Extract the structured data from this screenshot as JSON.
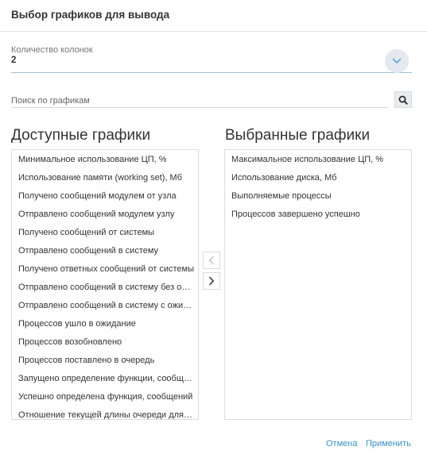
{
  "dialog": {
    "title": "Выбор графиков для вывода"
  },
  "columns": {
    "label": "Количество колонок",
    "value": "2"
  },
  "search": {
    "placeholder": "Поиск по графикам"
  },
  "available": {
    "heading": "Доступные графики",
    "items": [
      "Минимальное использование ЦП, %",
      "Использование памяти (working set), Мб",
      "Получено сообщений модулем от узла",
      "Отправлено сообщений модулем узлу",
      "Получено сообщений от системы",
      "Отправлено сообщений в систему",
      "Получено ответных сообщений от системы",
      "Отправлено сообщений в систему без ожидания ответа",
      "Отправлено сообщений в систему с ожиданием ответа",
      "Процессов ушло в ожидание",
      "Процессов возобновлено",
      "Процессов поставлено в очередь",
      "Запущено определение функции, сообщений",
      "Успешно определена функция, сообщений",
      "Отношение текущей длины очереди для обработки"
    ]
  },
  "selected": {
    "heading": "Выбранные графики",
    "items": [
      "Максимальное использование ЦП, %",
      "Использование диска, Мб",
      "Выполняемые процессы",
      "Процессов завершено успешно"
    ]
  },
  "icons": {
    "columns_toggle": "chevron-down-icon",
    "search": "search-icon",
    "move_left": "chevron-left-icon",
    "move_right": "chevron-right-icon"
  },
  "colors": {
    "accent": "#3a8fc7",
    "toggle_bg": "#e3e9ee",
    "field_underline": "#9fbed2"
  },
  "footer": {
    "cancel": "Отмена",
    "apply": "Применить"
  }
}
